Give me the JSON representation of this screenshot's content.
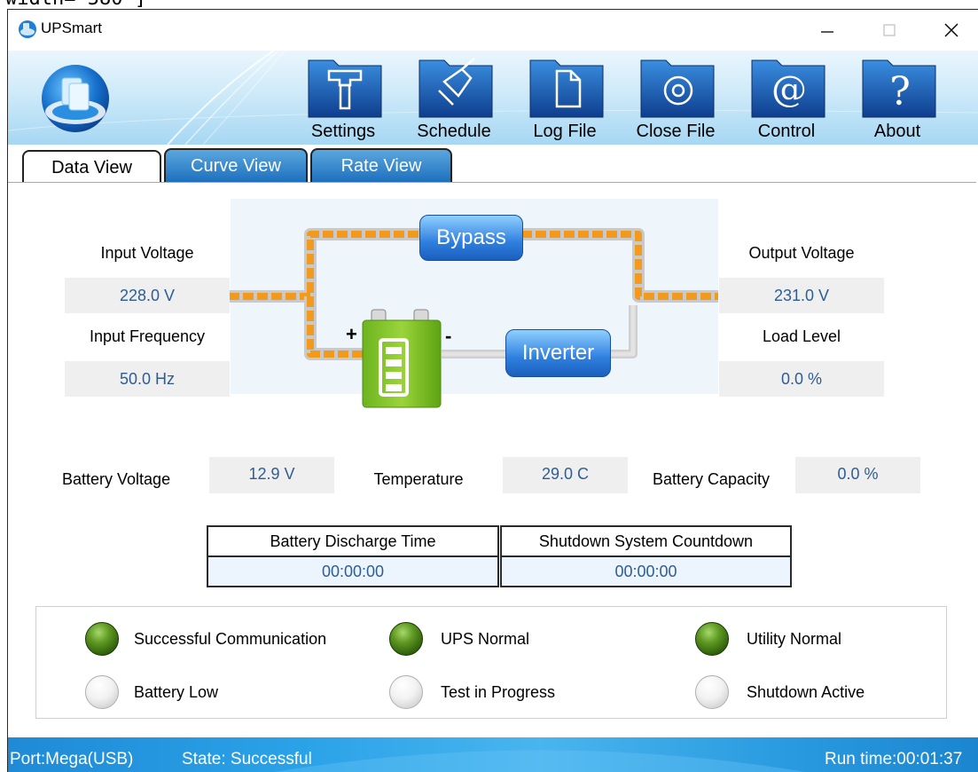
{
  "window": {
    "partial_top_text": "width=\"580\"]",
    "title": "UPSmart"
  },
  "toolbar": {
    "buttons": [
      {
        "label": "Settings",
        "icon": "hammer-icon"
      },
      {
        "label": "Schedule",
        "icon": "pencil-icon"
      },
      {
        "label": "Log File",
        "icon": "document-icon"
      },
      {
        "label": "Close File",
        "icon": "disc-icon"
      },
      {
        "label": "Control",
        "icon": "at-icon"
      },
      {
        "label": "About",
        "icon": "question-icon"
      }
    ]
  },
  "tabs": [
    {
      "label": "Data View",
      "active": true
    },
    {
      "label": "Curve View",
      "active": false
    },
    {
      "label": "Rate View",
      "active": false
    }
  ],
  "diagram": {
    "bypass_label": "Bypass",
    "inverter_label": "Inverter",
    "plus_sign": "+",
    "minus_sign": "-"
  },
  "readings": {
    "input_voltage_label": "Input Voltage",
    "input_voltage": "228.0 V",
    "input_frequency_label": "Input Frequency",
    "input_frequency": "50.0 Hz",
    "output_voltage_label": "Output Voltage",
    "output_voltage": "231.0 V",
    "load_level_label": "Load Level",
    "load_level": "0.0 %",
    "battery_voltage_label": "Battery Voltage",
    "battery_voltage": "12.9 V",
    "temperature_label": "Temperature",
    "temperature": "29.0 C",
    "battery_capacity_label": "Battery Capacity",
    "battery_capacity": "0.0 %"
  },
  "timers": {
    "discharge_header": "Battery Discharge Time",
    "discharge_value": "00:00:00",
    "countdown_header": "Shutdown System Countdown",
    "countdown_value": "00:00:00"
  },
  "indicators": [
    {
      "label": "Successful Communication",
      "on": true
    },
    {
      "label": "UPS Normal",
      "on": true
    },
    {
      "label": "Utility Normal",
      "on": true
    },
    {
      "label": "Battery Low",
      "on": false
    },
    {
      "label": "Test in Progress",
      "on": false
    },
    {
      "label": "Shutdown Active",
      "on": false
    }
  ],
  "colors": {
    "led_on": "#5f9a23",
    "flow_active": "#f29a1e",
    "value_text": "#2d5d95",
    "status_bar": "#2aa2e8"
  },
  "statusbar": {
    "port": "Port:Mega(USB)",
    "state": "State: Successful",
    "run_time": "Run time:00:01:37"
  }
}
